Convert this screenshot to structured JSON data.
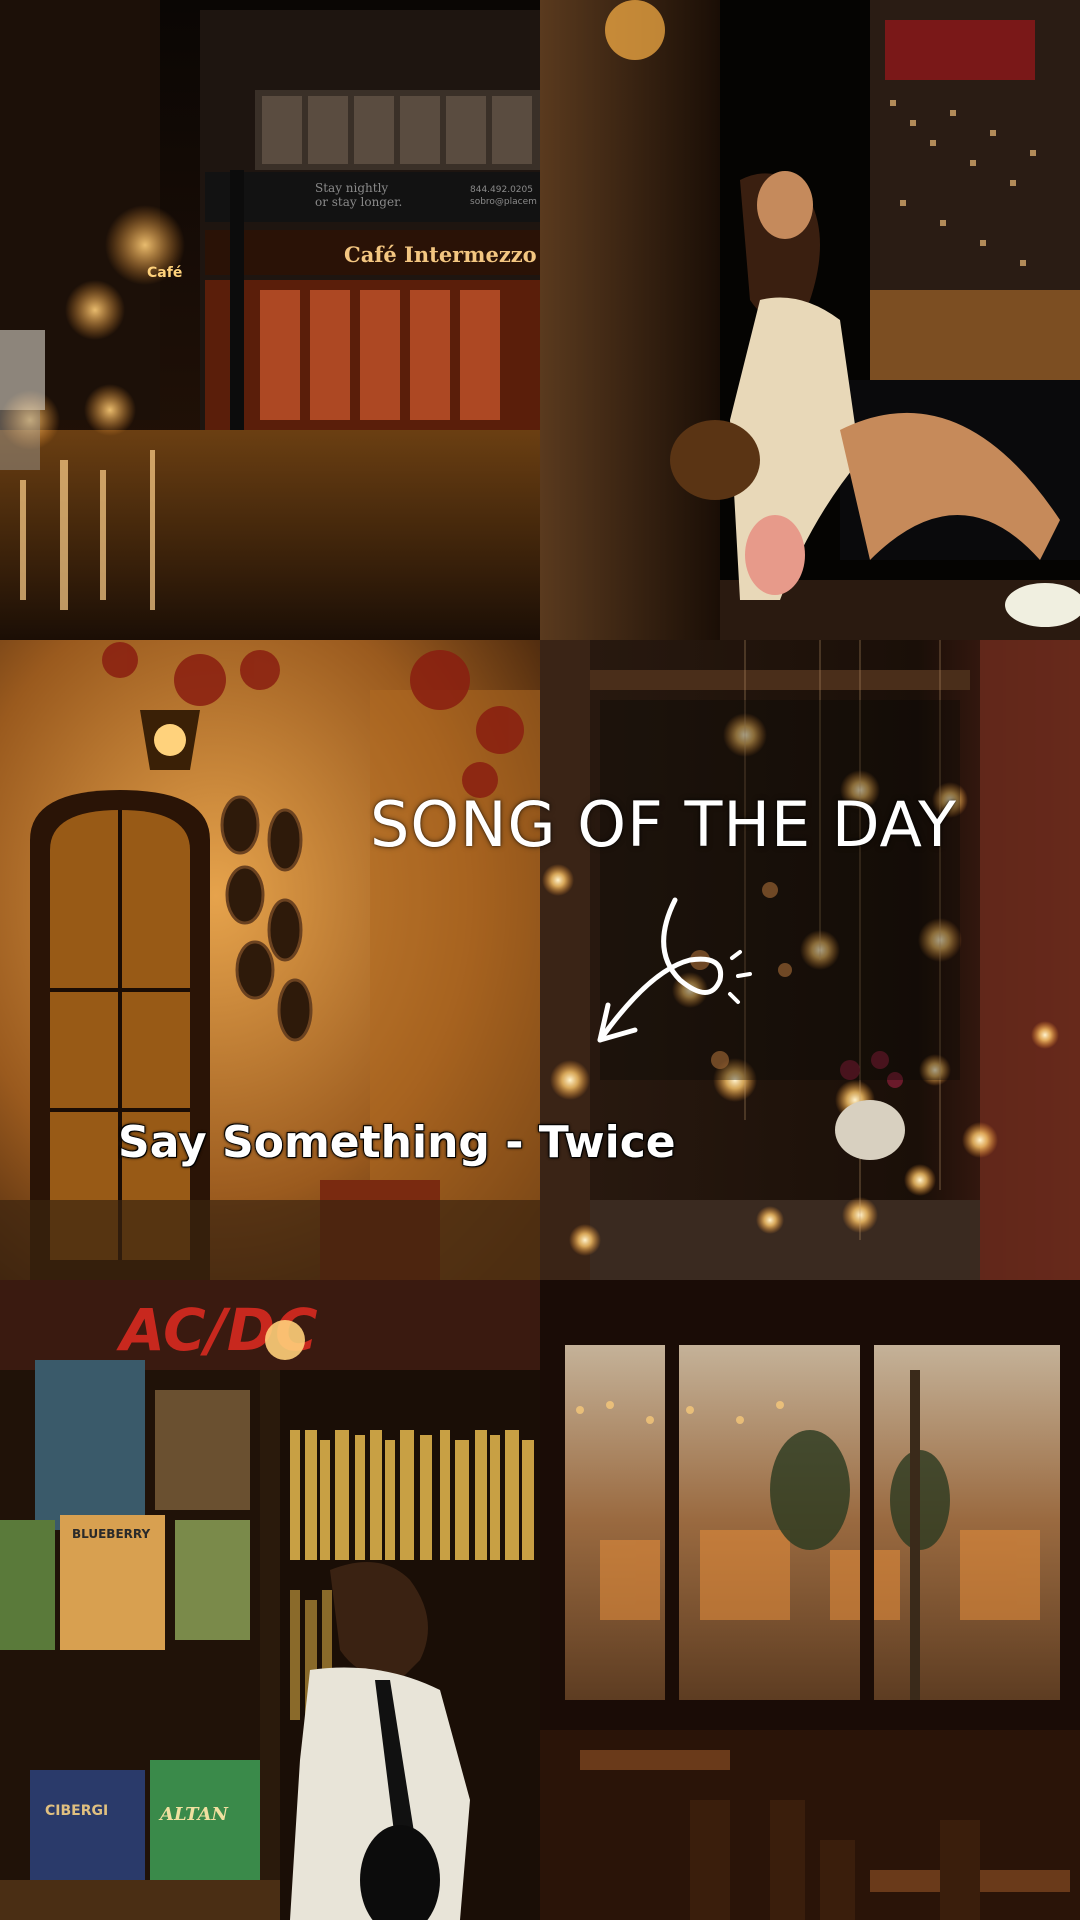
{
  "overlay": {
    "title": "SONG OF THE DAY",
    "song": "Say Something - Twice",
    "arrow_icon": "hand-drawn-arrow-icon"
  },
  "photos": {
    "cafe_street": {
      "sign_main": "Café Intermezzo",
      "sign_side": "Café",
      "banner_line1": "Stay nightly",
      "banner_line2": "or stay longer.",
      "banner_phone": "844.492.0205",
      "banner_web": "sobro@placem"
    },
    "bookshop": {
      "poster_text": "AC/DC",
      "book1": "BLUEBERRY",
      "book2": "ALTAN",
      "book3": "CIBERGI"
    }
  },
  "palette": {
    "warm_glow": "#ffb347",
    "amber": "#c8781e",
    "dark": "#1a0d05",
    "cream": "#f4e7c8"
  }
}
